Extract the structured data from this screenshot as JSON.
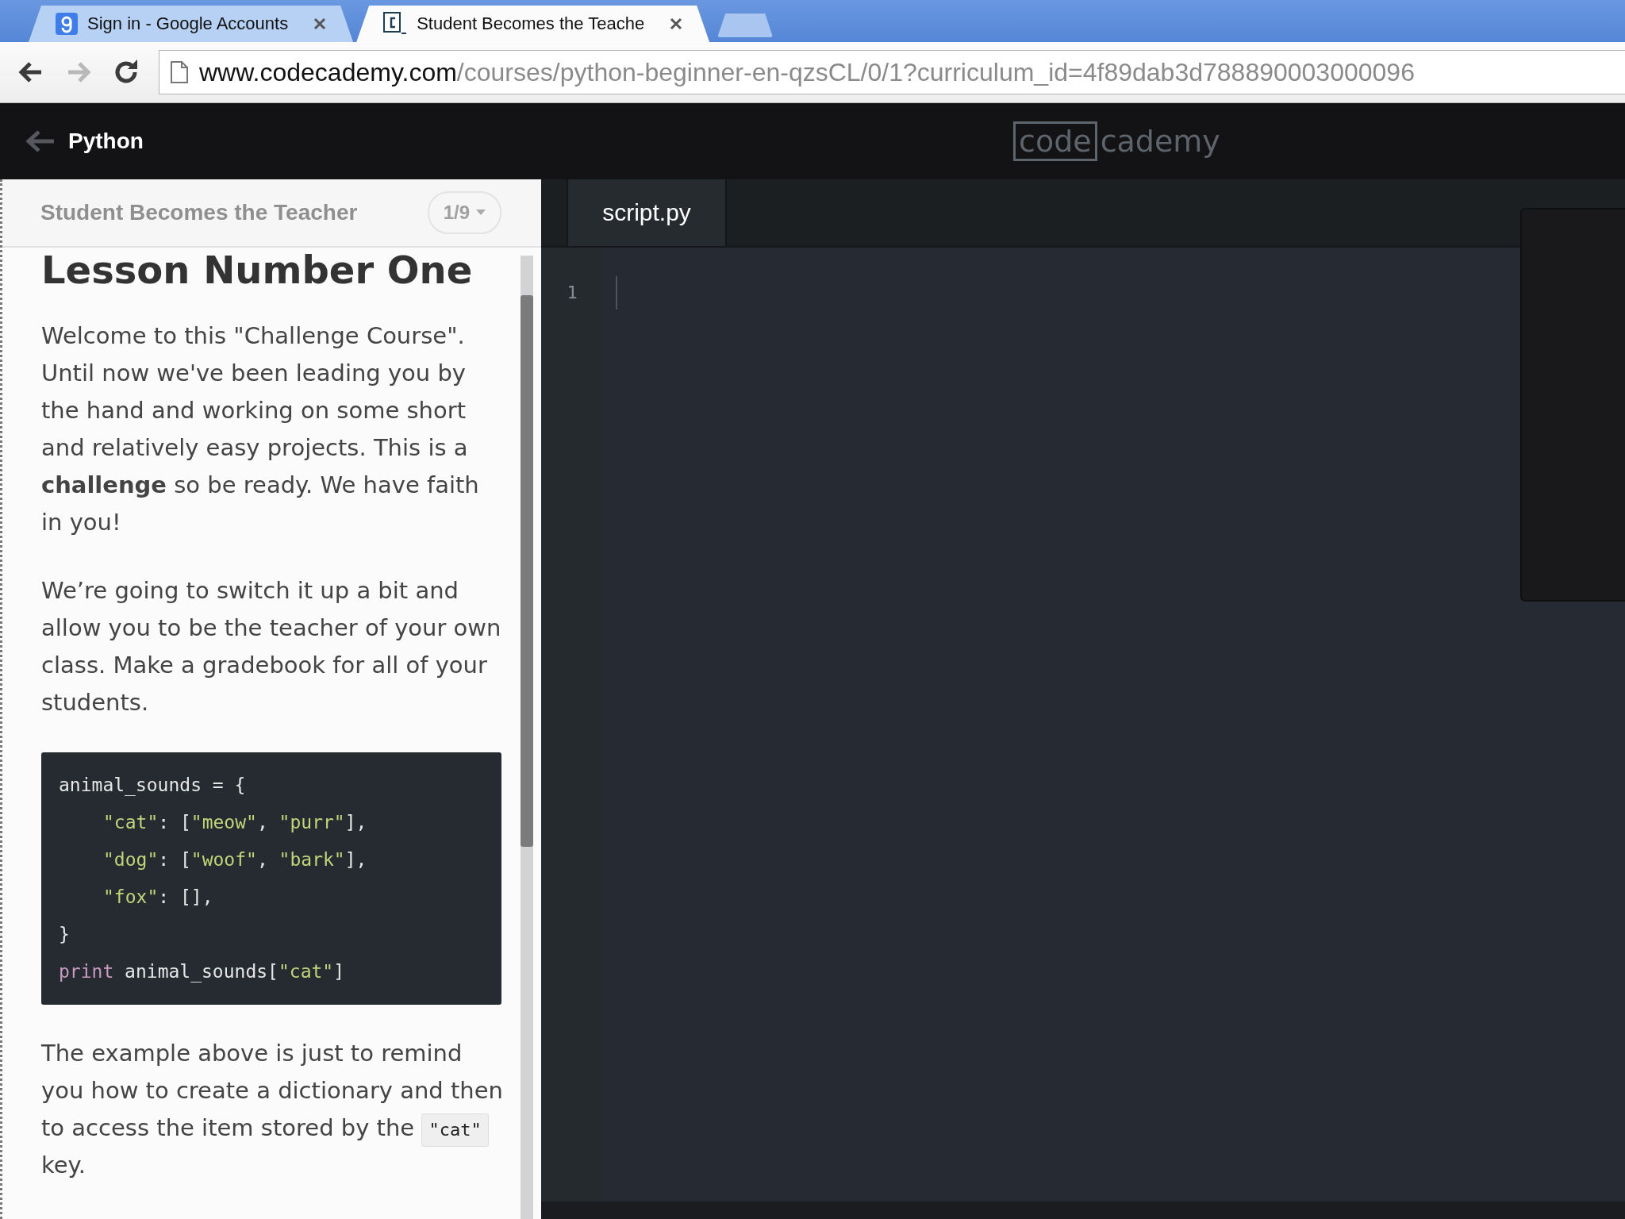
{
  "browser": {
    "tabs": [
      {
        "title": "Sign in - Google Accounts",
        "selected": false,
        "kind": "google"
      },
      {
        "title": "Student Becomes the Teache",
        "selected": true,
        "kind": "codecademy"
      }
    ],
    "nav": [
      {
        "kind": "back",
        "disabled": false
      },
      {
        "kind": "forward",
        "disabled": true
      },
      {
        "kind": "reload",
        "disabled": false
      }
    ],
    "url": {
      "host": "www.codecademy.com",
      "path": "/courses/python-beginner-en-qzsCL/0/1?curriculum_id=4f89dab3d788890003000096"
    }
  },
  "app_header": {
    "back_label": "Python",
    "logo": {
      "boxed": "code",
      "rest": "cademy"
    }
  },
  "lesson": {
    "title": "Student Becomes the Teacher",
    "progress": "1/9",
    "heading": "Lesson Number One",
    "blocks": [
      {
        "kind": "paragraph",
        "parts": [
          {
            "kind": "text",
            "text": "Welcome to this \"Challenge Course\". Until now we've been leading you by the hand and working on some short and relatively easy projects. This is a **challenge** so be ready. We have faith in you!"
          }
        ]
      },
      {
        "kind": "paragraph",
        "parts": [
          {
            "kind": "text",
            "text": "We’re going to switch it up a bit and allow you to be the teacher of your own class. Make a gradebook for all of your students."
          }
        ]
      },
      {
        "kind": "code",
        "lines": [
          {
            "indented": false,
            "tokens": [
              {
                "kind": "plain",
                "text": "animal_sounds = {"
              }
            ]
          },
          {
            "indented": true,
            "tokens": [
              {
                "kind": "string",
                "text": "\"cat\""
              },
              {
                "kind": "plain",
                "text": ": ["
              },
              {
                "kind": "string",
                "text": "\"meow\""
              },
              {
                "kind": "plain",
                "text": ", "
              },
              {
                "kind": "string",
                "text": "\"purr\""
              },
              {
                "kind": "plain",
                "text": "],"
              }
            ]
          },
          {
            "indented": true,
            "tokens": [
              {
                "kind": "string",
                "text": "\"dog\""
              },
              {
                "kind": "plain",
                "text": ": ["
              },
              {
                "kind": "string",
                "text": "\"woof\""
              },
              {
                "kind": "plain",
                "text": ", "
              },
              {
                "kind": "string",
                "text": "\"bark\""
              },
              {
                "kind": "plain",
                "text": "],"
              }
            ]
          },
          {
            "indented": true,
            "tokens": [
              {
                "kind": "string",
                "text": "\"fox\""
              },
              {
                "kind": "plain",
                "text": ": [],"
              }
            ]
          },
          {
            "indented": false,
            "tokens": [
              {
                "kind": "plain",
                "text": "}"
              }
            ]
          },
          {
            "indented": false,
            "tokens": [
              {
                "kind": "keyword",
                "text": "print"
              },
              {
                "kind": "plain",
                "text": " animal_sounds["
              },
              {
                "kind": "string",
                "text": "\"cat\""
              },
              {
                "kind": "plain",
                "text": "]"
              }
            ]
          }
        ]
      },
      {
        "kind": "paragraph",
        "parts": [
          {
            "kind": "text",
            "text": "The example above is just to remind you how to create a dictionary and then to access the item stored by the "
          },
          {
            "kind": "code",
            "text": "\"cat\""
          },
          {
            "kind": "text",
            "text": " key."
          }
        ]
      }
    ]
  },
  "editor": {
    "tabs": [
      {
        "label": "script.py",
        "selected": true
      }
    ],
    "line_numbers": [
      "1"
    ]
  }
}
